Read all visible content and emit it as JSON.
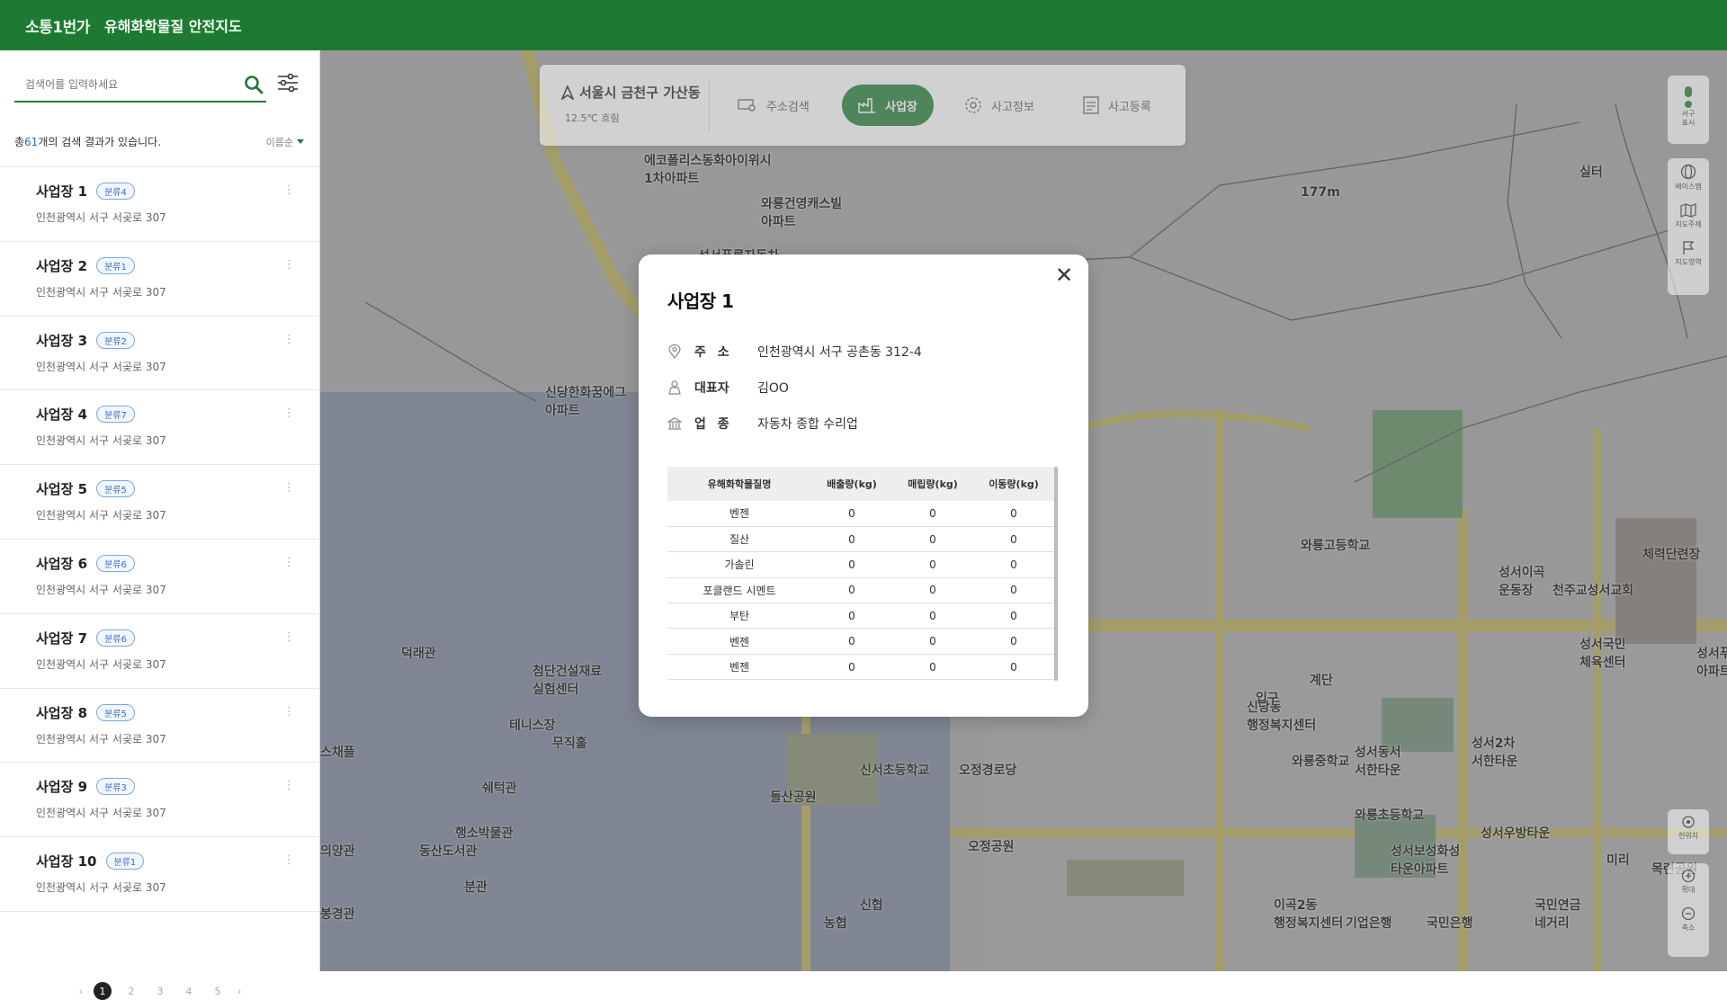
{
  "header": {
    "logo": "소통1번가",
    "title": "유해화학물질 안전지도"
  },
  "search": {
    "placeholder": "검색어를 입력하세요"
  },
  "results": {
    "prefix": "총 ",
    "count": "61",
    "suffix": "개의 검색 결과가 있습니다.",
    "sort": "이름순"
  },
  "items": [
    {
      "name": "사업장 1",
      "badge": "분류4",
      "addr": "인천광역시 서구 서곶로 307"
    },
    {
      "name": "사업장 2",
      "badge": "분류1",
      "addr": "인천광역시 서구 서곶로 307"
    },
    {
      "name": "사업장 3",
      "badge": "분류2",
      "addr": "인천광역시 서구 서곶로 307"
    },
    {
      "name": "사업장 4",
      "badge": "분류7",
      "addr": "인천광역시 서구 서곶로 307"
    },
    {
      "name": "사업장 5",
      "badge": "분류5",
      "addr": "인천광역시 서구 서곶로 307"
    },
    {
      "name": "사업장 6",
      "badge": "분류6",
      "addr": "인천광역시 서구 서곶로 307"
    },
    {
      "name": "사업장 7",
      "badge": "분류6",
      "addr": "인천광역시 서구 서곶로 307"
    },
    {
      "name": "사업장 8",
      "badge": "분류5",
      "addr": "인천광역시 서구 서곶로 307"
    },
    {
      "name": "사업장 9",
      "badge": "분류3",
      "addr": "인천광역시 서구 서곶로 307"
    },
    {
      "name": "사업장 10",
      "badge": "분류1",
      "addr": "인천광역시 서구 서곶로 307"
    }
  ],
  "pager": {
    "prev": "‹",
    "pages": [
      "1",
      "2",
      "3",
      "4",
      "5"
    ],
    "next": "›",
    "current": "1"
  },
  "toolbar": {
    "city": "서울시 금천구 가산동",
    "weather": "12.5℃  흐림",
    "address_search": "주소검색",
    "business": "사업장",
    "accident_info": "사고정보",
    "accident_register": "사고등록"
  },
  "rightctl": {
    "label1": "서구\n표시",
    "basemap": "베이스맵",
    "theme": "지도주제",
    "area": "지도영역",
    "current": "현위치",
    "zoomin": "확대",
    "zoomout": "축소"
  },
  "map_labels": [
    "에코폴리스동화아이위시\n1차아파트",
    "와룡건영캐스빌\n아파트",
    "성서푸른자동차",
    "신당한화꿈에그\n아파트",
    "와룡고등학교",
    "성서이곡\n운동장",
    "천주교성서교회",
    "성서국민\n체육센터",
    "성서푸른마을\n아파트",
    "와룡중학교",
    "성서동서\n서한타운",
    "성서2차\n서한타운",
    "신당동\n행정복지센터",
    "신서초등학교",
    "오정경로당",
    "와룡초등학교",
    "성서우방타운",
    "성서보성화성\n타운아파트",
    "돌산공원",
    "오정공원",
    "이곡2동\n행정복지센터",
    "첨단건설재료\n실험센터",
    "테니스장",
    "행소박물관",
    "동산도서관",
    "봉경관",
    "의양관",
    "분관",
    "덕래관",
    "스채플",
    "쉐턱관",
    "무직홀",
    "실터",
    "계단",
    "177m",
    "신협",
    "농협",
    "기업은행",
    "국민은행",
    "국민연금\n네거리",
    "체력단련장",
    "목련공원",
    "미리",
    "입구"
  ],
  "modal": {
    "title": "사업장 1",
    "close": "✕",
    "address_label": "주 소",
    "address": "인천광역시 서구 공촌동 312-4",
    "ceo_label": "대표자",
    "ceo": "김OO",
    "industry_label": "업 종",
    "industry": "자동차 종합 수리업",
    "table": {
      "headers": [
        "유해화학물질명",
        "배출량(kg)",
        "매립량(kg)",
        "이동량(kg)"
      ],
      "rows": [
        [
          "벤젠",
          "0",
          "0",
          "0"
        ],
        [
          "질산",
          "0",
          "0",
          "0"
        ],
        [
          "가솔린",
          "0",
          "0",
          "0"
        ],
        [
          "포클랜드 시멘트",
          "0",
          "0",
          "0"
        ],
        [
          "부탄",
          "0",
          "0",
          "0"
        ],
        [
          "벤젠",
          "0",
          "0",
          "0"
        ],
        [
          "벤젠",
          "0",
          "0",
          "0"
        ]
      ]
    }
  },
  "colors": {
    "brand": "#1e7a32",
    "badge": "#3a6ec0"
  }
}
